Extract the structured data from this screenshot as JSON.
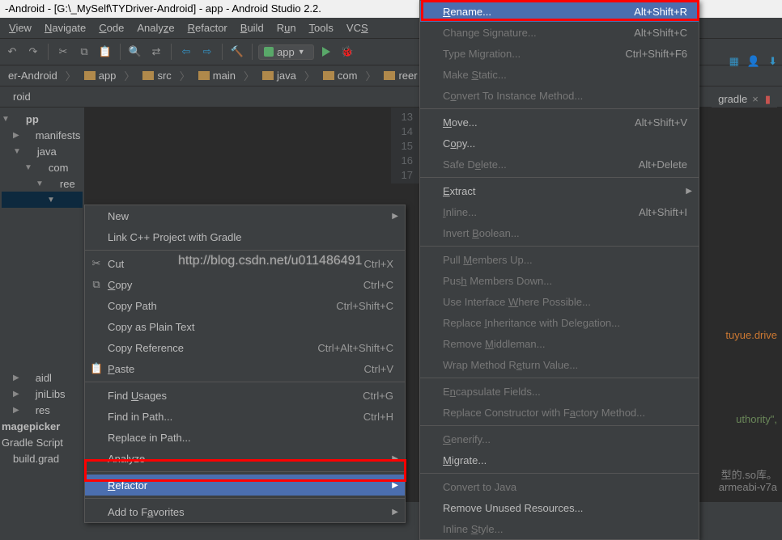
{
  "title": "-Android - [G:\\_MySelf\\TYDriver-Android] - app - Android Studio 2.2.",
  "menubar": [
    "View",
    "Navigate",
    "Code",
    "Analyze",
    "Refactor",
    "Build",
    "Run",
    "Tools",
    "VCS"
  ],
  "toolbar_app": "app",
  "breadcrumbs": [
    "er-Android",
    "app",
    "src",
    "main",
    "java",
    "com",
    "reer"
  ],
  "nav_tab": "roid",
  "sidebar": {
    "root": "pp",
    "items": [
      "manifests",
      "java",
      "com",
      "ree"
    ],
    "bottom": [
      "aidl",
      "jniLibs",
      "res"
    ],
    "footer1": "magepicker",
    "footer2": "Gradle Script",
    "footer3": "build.grad"
  },
  "gutter": [
    "13",
    "14",
    "15",
    "16",
    "17"
  ],
  "right_tabs": {
    "gradle": "gradle"
  },
  "context_menu_1": [
    {
      "label": "New",
      "arrow": true
    },
    {
      "label": "Link C++ Project with Gradle"
    },
    {
      "sep": true
    },
    {
      "label": "Cut",
      "sc": "Ctrl+X",
      "icon": "✂"
    },
    {
      "label": "Copy",
      "sc": "Ctrl+C",
      "icon": "⧉",
      "u": 0
    },
    {
      "label": "Copy Path",
      "sc": "Ctrl+Shift+C"
    },
    {
      "label": "Copy as Plain Text"
    },
    {
      "label": "Copy Reference",
      "sc": "Ctrl+Alt+Shift+C"
    },
    {
      "label": "Paste",
      "sc": "Ctrl+V",
      "icon": "📋",
      "u": 0
    },
    {
      "sep": true
    },
    {
      "label": "Find Usages",
      "sc": "Ctrl+G",
      "u": 5
    },
    {
      "label": "Find in Path...",
      "sc": "Ctrl+H"
    },
    {
      "label": "Replace in Path..."
    },
    {
      "label": "Analyze",
      "arrow": true
    },
    {
      "sep": true
    },
    {
      "label": "Refactor",
      "highlighted": true,
      "arrow": true,
      "u": 0
    },
    {
      "sep": true
    },
    {
      "label": "Add to Favorites",
      "arrow": true,
      "u": 8
    }
  ],
  "context_menu_2": [
    {
      "label": "Rename...",
      "sc": "Alt+Shift+R",
      "highlighted": true,
      "u": 0
    },
    {
      "label": "Change Signature...",
      "sc": "Alt+Shift+C",
      "disabled": true
    },
    {
      "label": "Type Migration...",
      "sc": "Ctrl+Shift+F6",
      "disabled": true
    },
    {
      "label": "Make Static...",
      "disabled": true,
      "u": 5
    },
    {
      "label": "Convert To Instance Method...",
      "disabled": true,
      "u": 1
    },
    {
      "sep": true
    },
    {
      "label": "Move...",
      "sc": "Alt+Shift+V",
      "u": 0
    },
    {
      "label": "Copy...",
      "u": 1
    },
    {
      "label": "Safe Delete...",
      "sc": "Alt+Delete",
      "disabled": true,
      "u": 6
    },
    {
      "sep": true
    },
    {
      "label": "Extract",
      "arrow": true,
      "u": 0
    },
    {
      "label": "Inline...",
      "sc": "Alt+Shift+I",
      "disabled": true,
      "u": 0
    },
    {
      "label": "Invert Boolean...",
      "disabled": true,
      "u": 7
    },
    {
      "sep": true
    },
    {
      "label": "Pull Members Up...",
      "disabled": true,
      "u": 5
    },
    {
      "label": "Push Members Down...",
      "disabled": true,
      "u": 3
    },
    {
      "label": "Use Interface Where Possible...",
      "disabled": true,
      "u": 14
    },
    {
      "label": "Replace Inheritance with Delegation...",
      "disabled": true,
      "u": 8
    },
    {
      "label": "Remove Middleman...",
      "disabled": true,
      "u": 7
    },
    {
      "label": "Wrap Method Return Value...",
      "disabled": true,
      "u": 13
    },
    {
      "sep": true
    },
    {
      "label": "Encapsulate Fields...",
      "disabled": true,
      "u": 1
    },
    {
      "label": "Replace Constructor with Factory Method...",
      "disabled": true,
      "u": 26
    },
    {
      "sep": true
    },
    {
      "label": "Generify...",
      "disabled": true,
      "u": 0
    },
    {
      "label": "Migrate...",
      "u": 0
    },
    {
      "sep": true
    },
    {
      "label": "Convert to Java",
      "disabled": true
    },
    {
      "label": "Remove Unused Resources..."
    },
    {
      "label": "Inline Style...",
      "disabled": true,
      "u": 7
    }
  ],
  "watermark": "http://blog.csdn.net/u011486491",
  "code_snippets": {
    "s1": "tuyue.drive",
    "s2": "uthority\",",
    "s3": "型的.so库。",
    "s4": "armeabi-v7a"
  }
}
